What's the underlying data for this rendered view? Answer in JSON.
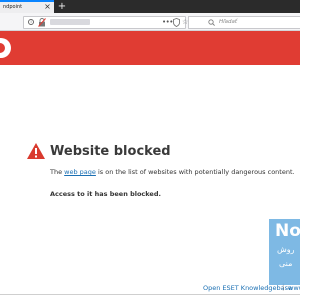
{
  "tab": {
    "title": "ndpoint",
    "close_glyph": "×",
    "new_tab_glyph": "+"
  },
  "toolbar": {
    "more_glyph": "•••",
    "star_glyph": "☆",
    "search_placeholder": "Hľadať"
  },
  "content": {
    "title": "Website blocked",
    "desc_before": "The ",
    "desc_link": "web page",
    "desc_after": " is on the list of websites with potentially dangerous content.",
    "access": "Access to it has been blocked."
  },
  "footer": {
    "kb_link": "Open ESET Knowledgebase",
    "separator": "|",
    "www": "www"
  },
  "watermark": {
    "big": "No",
    "line1": "روش",
    "line2": "منی"
  },
  "colors": {
    "banner": "#e03c33",
    "accent_link": "#1a6fb3",
    "tab_strip": "#2b2b2b",
    "watermark": "#5aa5dc"
  },
  "icons": {
    "info": "info-icon",
    "lock": "lock-crossed-icon",
    "shield": "shield-icon",
    "star": "star-icon",
    "search": "search-icon",
    "warning": "warning-triangle-icon",
    "eset": "eset-logo"
  }
}
